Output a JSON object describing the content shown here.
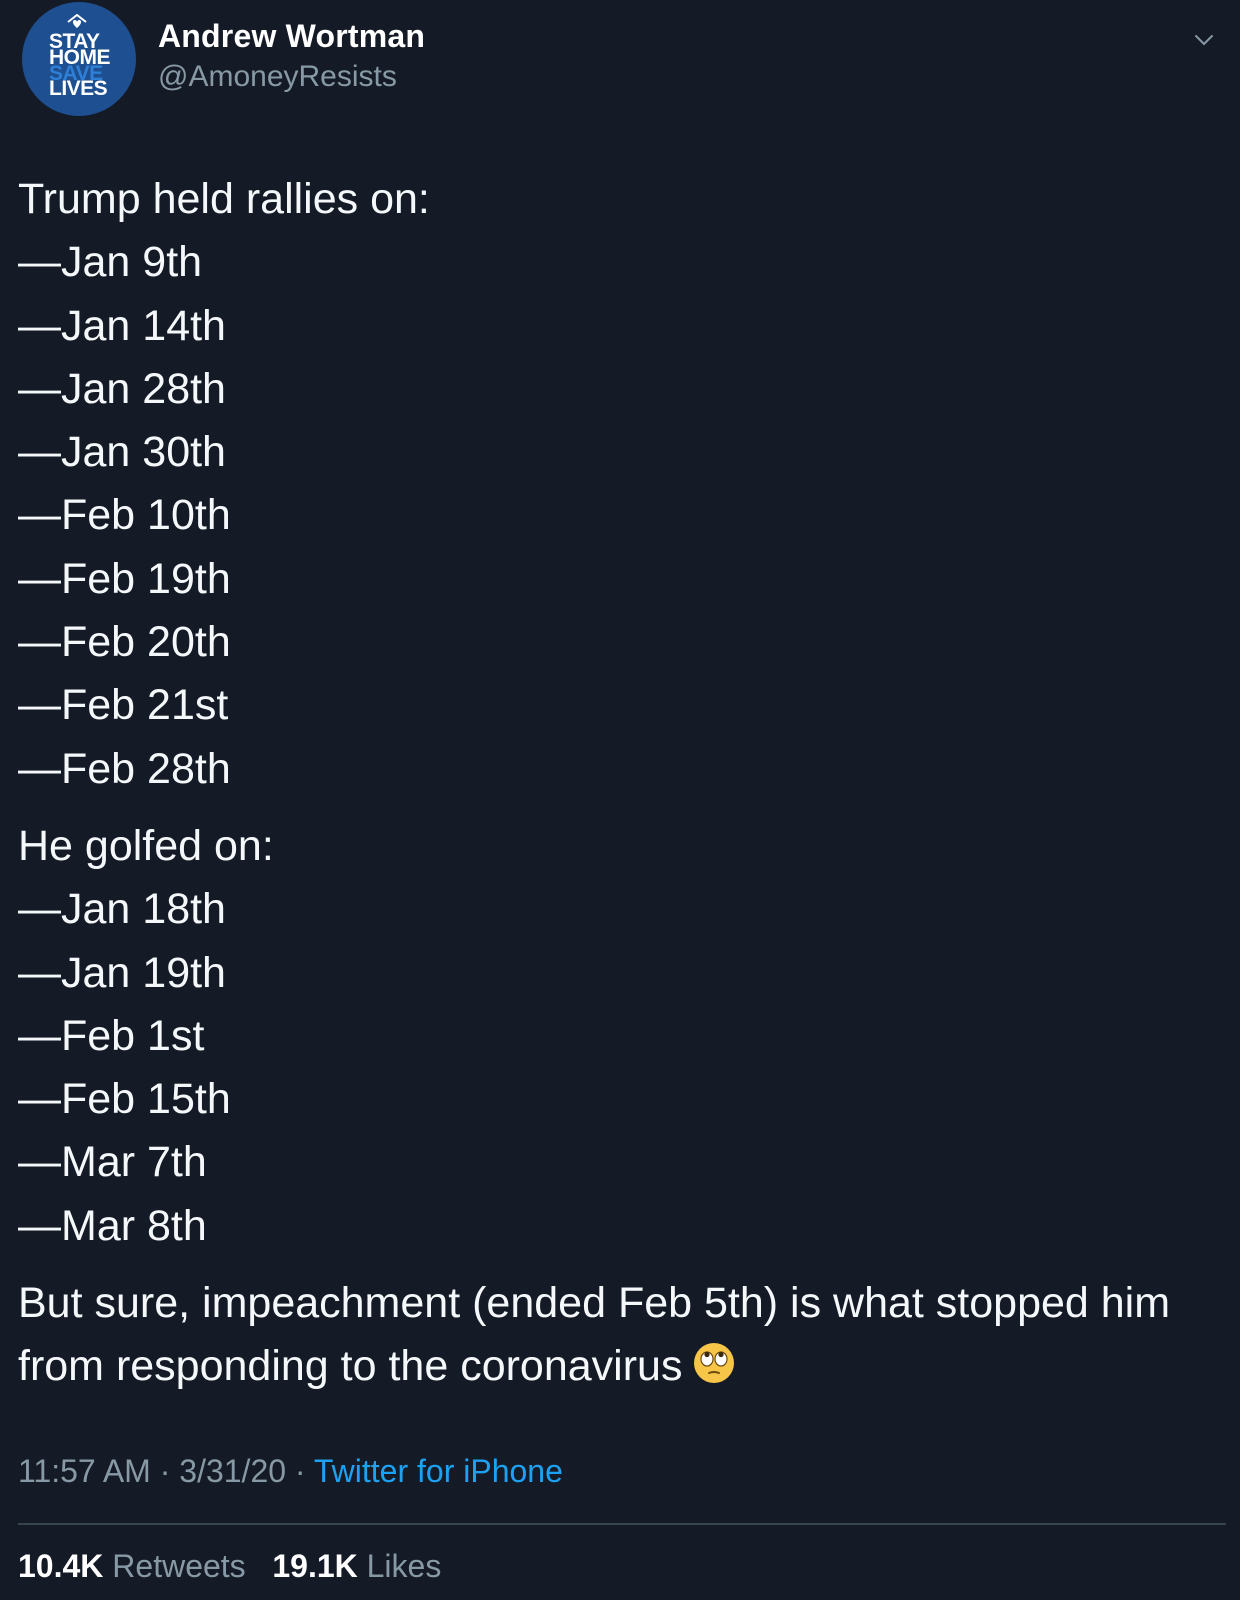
{
  "author": {
    "display_name": "Andrew Wortman",
    "handle": "@AmoneyResists",
    "avatar_text": [
      "STAY",
      "HOME",
      "SAVE",
      "LIVES"
    ]
  },
  "tweet": {
    "rallies_heading": "Trump held rallies on:",
    "rallies": [
      "—Jan 9th",
      "—Jan 14th",
      "—Jan 28th",
      "—Jan 30th",
      "—Feb 10th",
      "—Feb 19th",
      "—Feb 20th",
      "—Feb 21st",
      "—Feb 28th"
    ],
    "golf_heading": "He golfed on:",
    "golf": [
      "—Jan 18th",
      "—Jan 19th",
      "—Feb 1st",
      "—Feb 15th",
      "—Mar 7th",
      "—Mar 8th"
    ],
    "closing": "But sure, impeachment (ended Feb 5th) is what stopped him from responding to the coronavirus",
    "closing_emoji": "face-with-rolling-eyes-icon"
  },
  "meta": {
    "time": "11:57 AM",
    "separator": "·",
    "date": "3/31/20",
    "source": "Twitter for iPhone"
  },
  "stats": {
    "retweets_count": "10.4K",
    "retweets_label": "Retweets",
    "likes_count": "19.1K",
    "likes_label": "Likes"
  },
  "colors": {
    "background": "#151b26",
    "text": "#f5f8fa",
    "secondary_text": "#8899a6",
    "link": "#1da1f2",
    "avatar_bg": "#1d4f91"
  }
}
